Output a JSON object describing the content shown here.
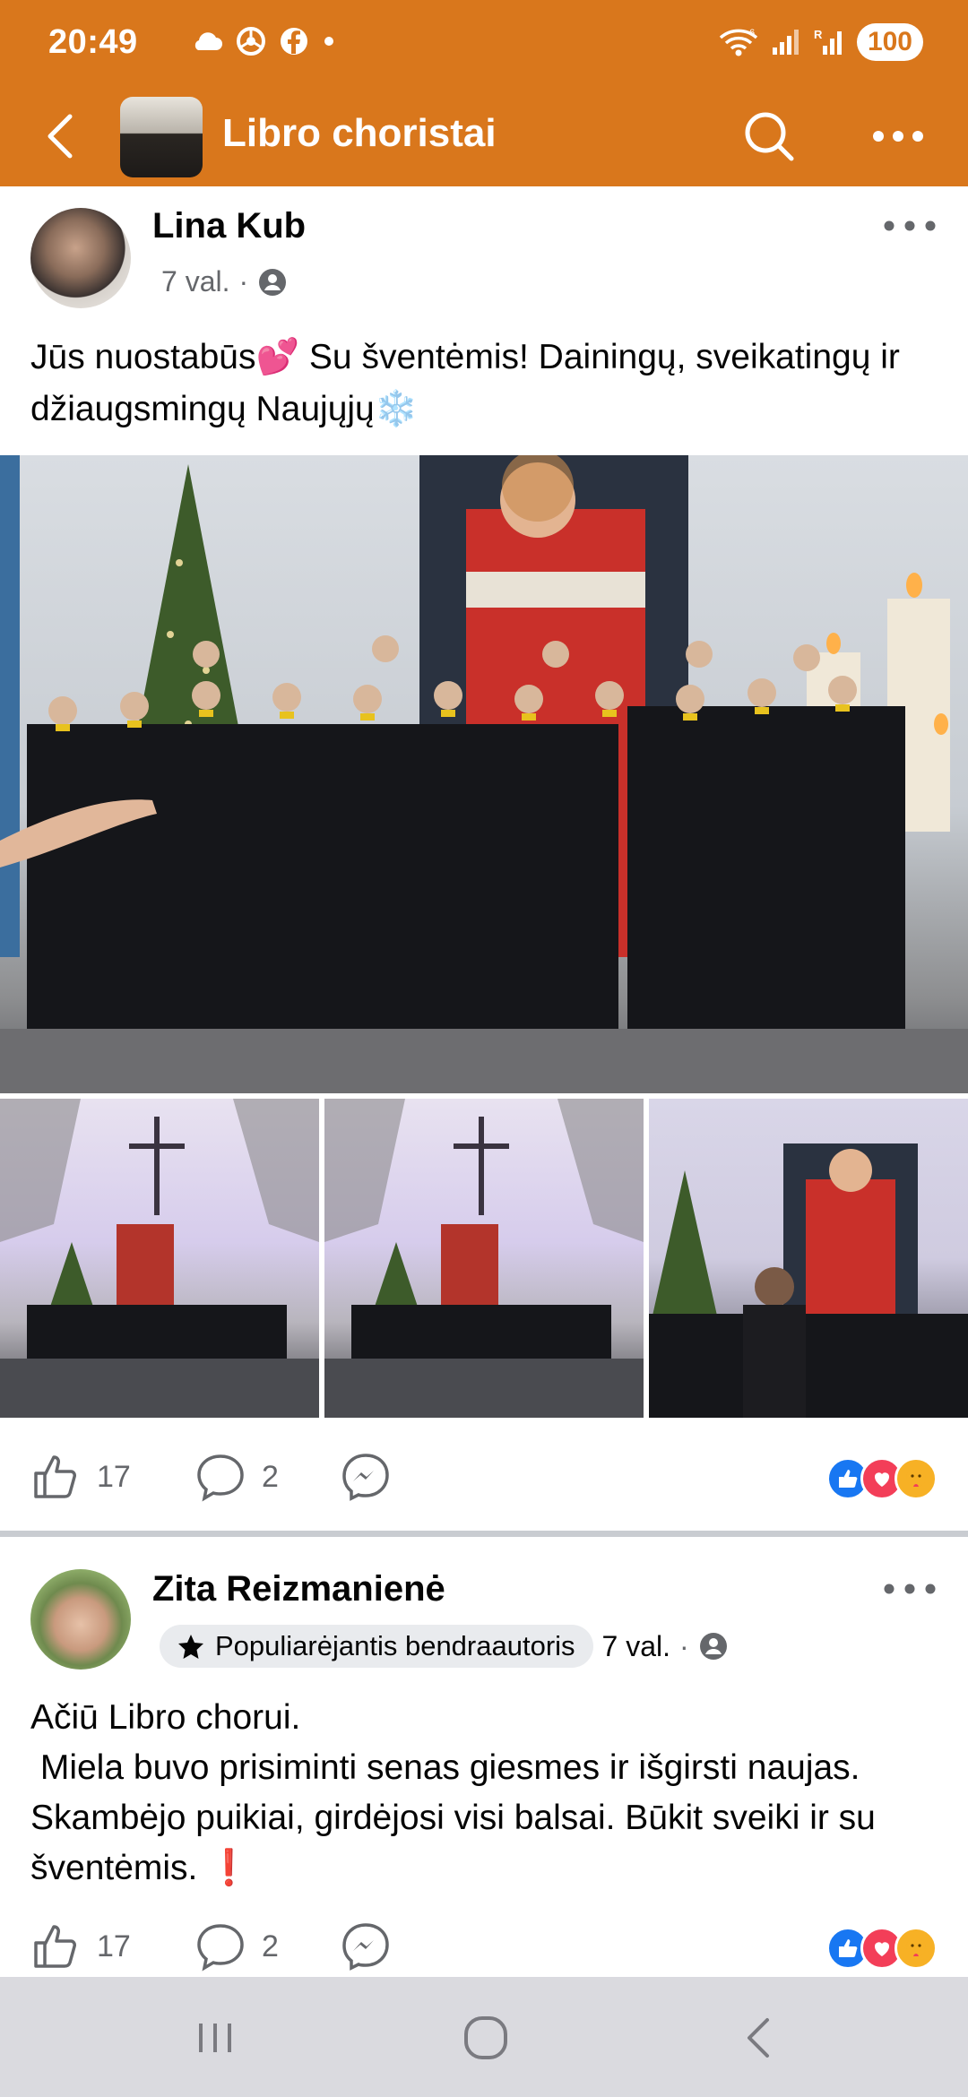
{
  "status_bar": {
    "time": "20:49",
    "icons": [
      "cloud-icon",
      "chrome-icon",
      "facebook-icon",
      "dot-icon"
    ],
    "right_icons": [
      "wifi-icon",
      "signal-icon",
      "signal-roaming-icon"
    ],
    "battery": "100"
  },
  "header": {
    "title": "Libro choristai",
    "background_color": "#d9771c"
  },
  "posts": [
    {
      "author": "Lina Kub",
      "time": "7 val.",
      "separator": "·",
      "privacy_icon": "group-members-icon",
      "text_parts": [
        "Jūs nuostabūs",
        "💕",
        " Su šventėmis! Dainingų, sveikatingų ir džiaugsmingų Naujųjų",
        "❄️"
      ],
      "likes": "17",
      "comments": "2",
      "reactions": [
        "like",
        "love",
        "care"
      ]
    },
    {
      "author": "Zita Reizmanienė",
      "badge": "Populiarėjantis bendraautoris",
      "time": "7 val.",
      "separator": "·",
      "privacy_icon": "group-members-icon",
      "text_lines": [
        "Ačiū Libro chorui.",
        " Miela buvo prisiminti senas giesmes ir išgirsti naujas. Skambėjo puikiai, girdėjosi visi balsai. Būkit sveiki ir su šventėmis. "
      ],
      "text_emoji": "❗",
      "likes": "17",
      "comments": "2",
      "reactions": [
        "like",
        "love",
        "care"
      ]
    }
  ]
}
